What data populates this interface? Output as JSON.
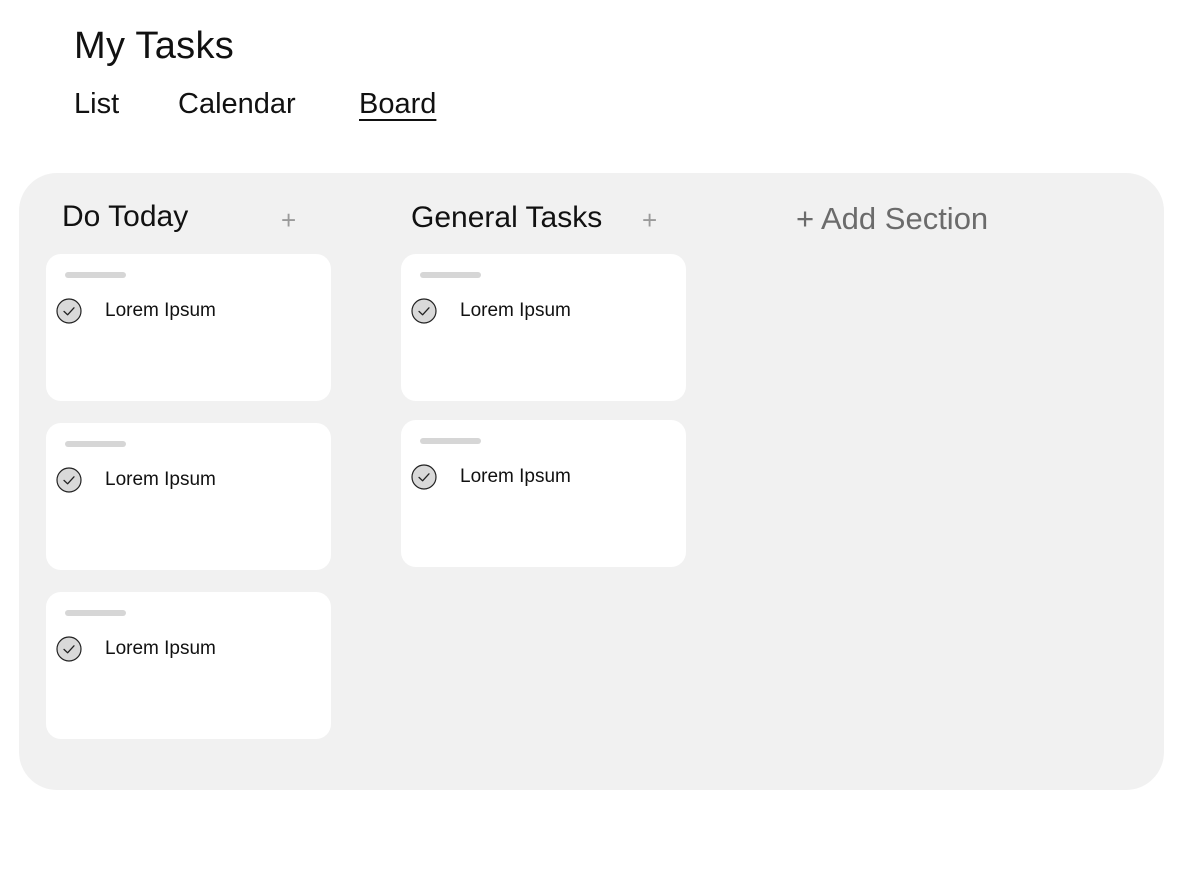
{
  "header": {
    "title": "My Tasks",
    "tabs": [
      {
        "label": "List",
        "active": false
      },
      {
        "label": "Calendar",
        "active": false
      },
      {
        "label": "Board",
        "active": true
      }
    ]
  },
  "board": {
    "sections": [
      {
        "title": "Do Today",
        "add_label": "+",
        "cards": [
          {
            "label": "Lorem Ipsum",
            "checked": true
          },
          {
            "label": "Lorem Ipsum",
            "checked": true
          },
          {
            "label": "Lorem Ipsum",
            "checked": true
          }
        ]
      },
      {
        "title": "General Tasks",
        "add_label": "+",
        "cards": [
          {
            "label": "Lorem Ipsum",
            "checked": true
          },
          {
            "label": "Lorem Ipsum",
            "checked": true
          }
        ]
      }
    ],
    "add_section_label": "+ Add Section"
  },
  "colors": {
    "board_background": "#f1f1f1",
    "card_background": "#ffffff",
    "muted_text": "#6b6b6b",
    "check_fill": "#d9d9d9"
  },
  "icons": {
    "check": "check-circle-icon",
    "add": "plus-icon"
  }
}
